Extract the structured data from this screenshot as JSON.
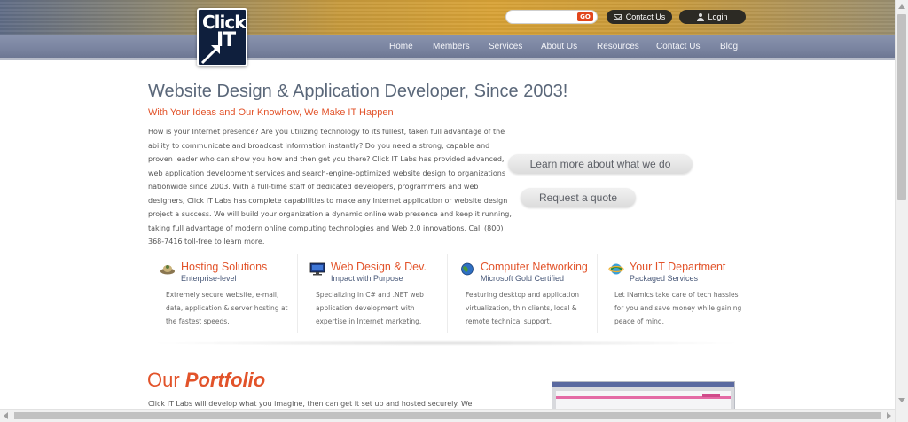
{
  "header": {
    "logo": {
      "line1": "Click",
      "line2": "IT"
    },
    "search": {
      "placeholder": "",
      "go_label": "GO"
    },
    "contact_button": "Contact Us",
    "login_button": "Login"
  },
  "nav": {
    "items": [
      {
        "label": "Home"
      },
      {
        "label": "Members"
      },
      {
        "label": "Services"
      },
      {
        "label": "About Us"
      },
      {
        "label": "Resources"
      },
      {
        "label": "Contact Us"
      },
      {
        "label": "Blog"
      }
    ]
  },
  "main": {
    "title": "Website Design & Application Developer, Since 2003!",
    "subtitle": "With Your Ideas and Our Knowhow, We Make IT Happen",
    "intro": "How is your Internet presence? Are you utilizing technology to its fullest, taken full advantage of the ability to communicate and broadcast information instantly? Do you need a strong, capable and proven leader who can show you how and then get you there? Click IT Labs has provided advanced, web application development services and search-engine-optimized website design to organizations nationwide since 2003. With a full-time staff of dedicated developers, programmers and web designers, Click IT Labs has complete capabilities to make any Internet application or website design project a success. We will build your organization a dynamic online web presence and keep it running, taking full advantage of modern online computing technologies and Web 2.0 innovations. Call (800) 368-7416 toll-free to learn more.",
    "cta_learn": "Learn more about what we do",
    "cta_quote": "Request a quote"
  },
  "services": [
    {
      "title": "Hosting Solutions",
      "subtitle": "Enterprise-level",
      "body": "Extremely secure website, e-mail, data, application & server hosting at the fastest speeds.",
      "icon": "hosting-icon"
    },
    {
      "title": "Web Design & Dev.",
      "subtitle": "Impact with Purpose",
      "body": "Specializing in C# and .NET web application development with expertise in Internet marketing.",
      "icon": "monitor-icon"
    },
    {
      "title": "Computer Networking",
      "subtitle": "Microsoft Gold Certified",
      "body": "Featuring desktop and application virtualization, thin clients, local & remote technical support.",
      "icon": "network-globe-icon"
    },
    {
      "title": "Your IT Department",
      "subtitle": "Packaged Services",
      "body": "Let iNamics take care of tech hassles for you and save money while gaining peace of mind.",
      "icon": "ie-globe-icon"
    }
  ],
  "portfolio": {
    "title_prefix": "Our ",
    "title_emph": "Portfolio",
    "text": "Click IT Labs will develop what you imagine, then can get it set up and hosted securely. We"
  },
  "colors": {
    "accent": "#e2532a",
    "nav_bar": "#7a84a0",
    "title_gray": "#5a6779",
    "sub_blue": "#4a5a7a"
  }
}
